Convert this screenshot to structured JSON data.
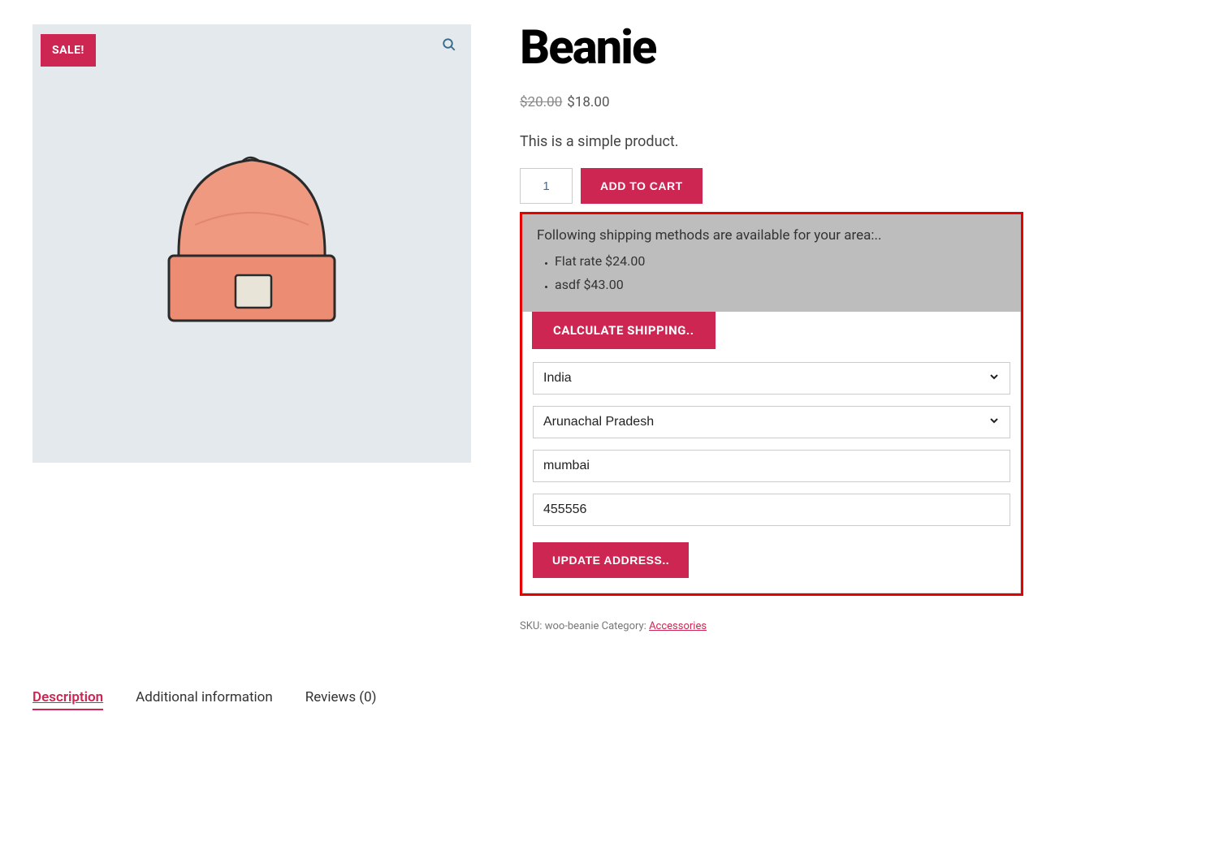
{
  "product": {
    "title": "Beanie",
    "old_price": "$20.00",
    "price": "$18.00",
    "description": "This is a simple product.",
    "sale_badge": "SALE!",
    "quantity": "1",
    "add_to_cart": "ADD TO CART"
  },
  "shipping": {
    "intro": "Following shipping methods are available for your area:..",
    "methods": [
      "Flat rate $24.00",
      "asdf $43.00"
    ],
    "calc_heading": "CALCULATE SHIPPING..",
    "country": "India",
    "state": "Arunachal Pradesh",
    "city": "mumbai",
    "postcode": "455556",
    "update_button": "UPDATE ADDRESS.."
  },
  "meta": {
    "sku_label": "SKU: ",
    "sku": "woo-beanie",
    "cat_label": " Category: ",
    "category": "Accessories"
  },
  "tabs": {
    "description": "Description",
    "additional": "Additional information",
    "reviews": "Reviews (0)"
  }
}
